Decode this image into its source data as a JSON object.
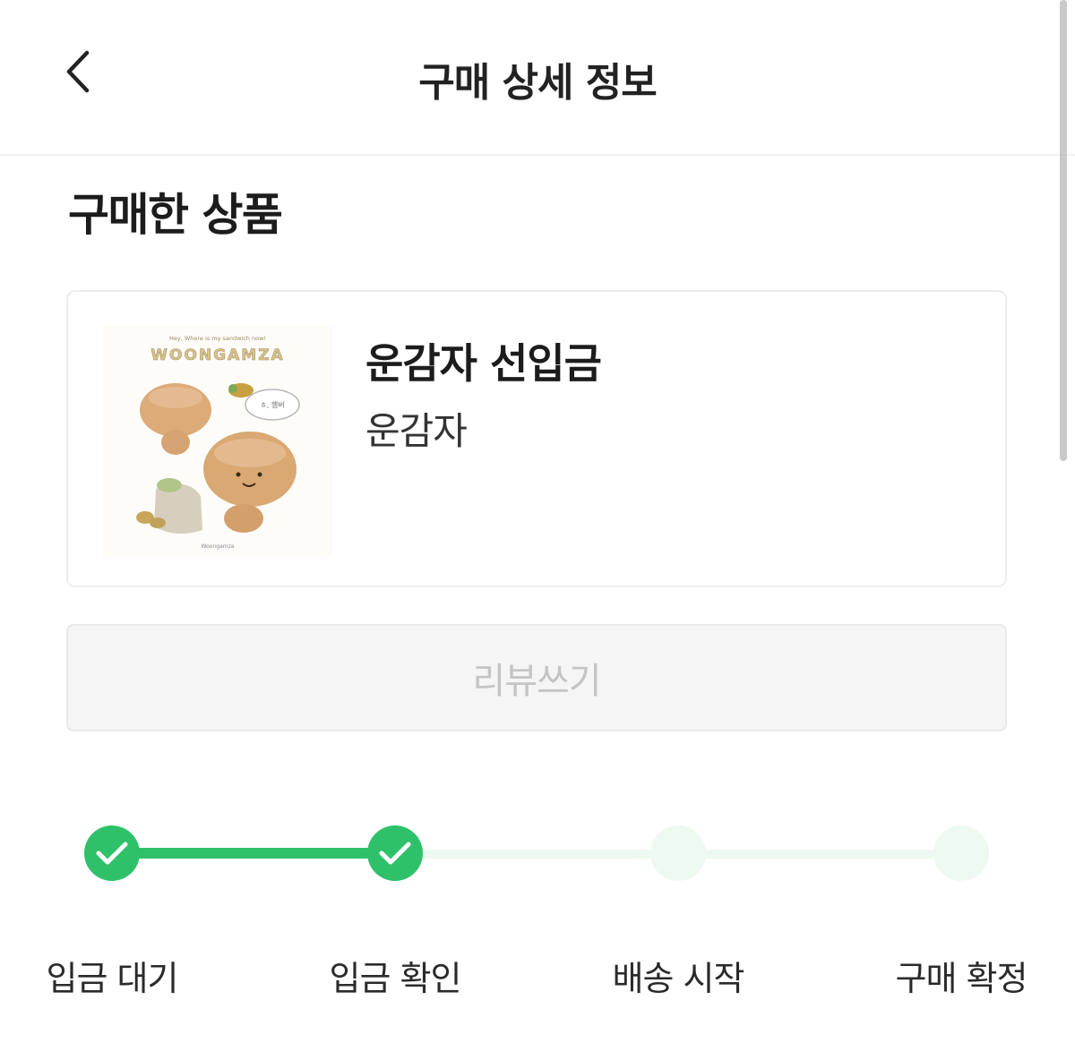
{
  "header": {
    "title": "구매 상세 정보",
    "back_icon": "chevron-left-icon"
  },
  "section": {
    "title": "구매한 상품"
  },
  "product": {
    "name": "운감자 선입금",
    "seller": "운감자",
    "thumbnail": {
      "title_text": "WOONGAMZA",
      "small_caption": "Hey, Where is my sandwich now!",
      "speech_text": "ㅎ, 햄버",
      "footer_text": "Woongamza"
    }
  },
  "review_button": {
    "label": "리뷰쓰기"
  },
  "progress": {
    "completed_count": 2,
    "steps": [
      {
        "label": "입금 대기",
        "status": "done"
      },
      {
        "label": "입금 확인",
        "status": "done"
      },
      {
        "label": "배송 시작",
        "status": "todo"
      },
      {
        "label": "구매 확정",
        "status": "todo"
      }
    ]
  },
  "colors": {
    "accent_green": "#2fc16a",
    "inactive_green": "#eef9f1",
    "review_text": "#c4c4c4"
  }
}
